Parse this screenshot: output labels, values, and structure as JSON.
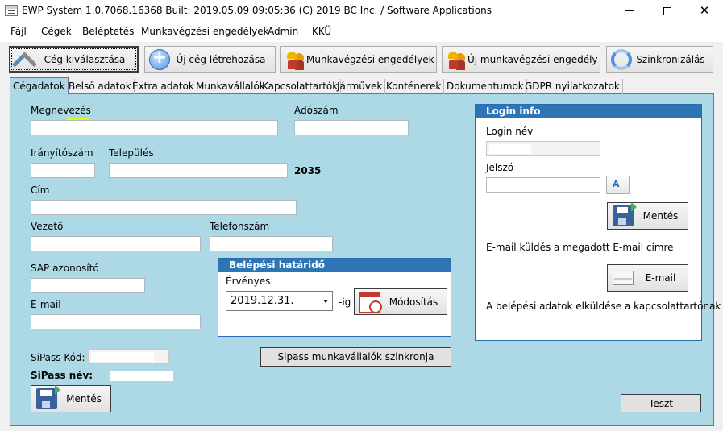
{
  "window": {
    "title": "EWP System 1.0.7068.16368 Built: 2019.05.09 09:05:36 (C) 2019 BC Inc. / Software Applications"
  },
  "menu": [
    "Fájl",
    "Cégek",
    "Beléptetés",
    "Munkavégzési engedélyek",
    "Admin",
    "KKÜ"
  ],
  "toolbar": {
    "select_company": "Cég kiválasztása",
    "new_company": "Új cég létrehozása",
    "work_permits": "Munkavégzési engedélyek",
    "new_work_permit": "Új munkavégzési engedély",
    "sync": "Szinkronizálás"
  },
  "tabs": [
    "Cégadatok",
    "Belső adatok",
    "Extra adatok",
    "Munkavállalók",
    "Kapcsolattartók",
    "Járművek",
    "Konténerek",
    "Dokumentumok",
    "GDPR nyilatkozatok"
  ],
  "form": {
    "name_label": "Megnevezés",
    "tax_label": "Adószám",
    "zip_label": "Irányítószám",
    "city_label": "Település",
    "code_value": "2035",
    "address_label": "Cím",
    "manager_label": "Vezető",
    "phone_label": "Telefonszám",
    "sap_label": "SAP azonosító",
    "email_label": "E-mail",
    "sipass_code_label": "SiPass Kód:",
    "sipass_name_label": "SiPass név:",
    "save_label": "Mentés"
  },
  "deadline": {
    "title": "Belépési határidő",
    "valid_label": "Érvényes:",
    "date_value": "2019.12.31.",
    "suffix": "-ig",
    "modify_label": "Módosítás"
  },
  "sipass_sync_label": "Sipass munkavállalók szinkronja",
  "login": {
    "title": "Login info",
    "login_name_label": "Login név",
    "password_label": "Jelszó",
    "save_label": "Mentés",
    "email_info": "E-mail küldés a megadott E-mail címre",
    "email_button": "E-mail",
    "send_info": "A belépési adatok elküldése a kapcsolattartónak"
  },
  "test_label": "Teszt"
}
